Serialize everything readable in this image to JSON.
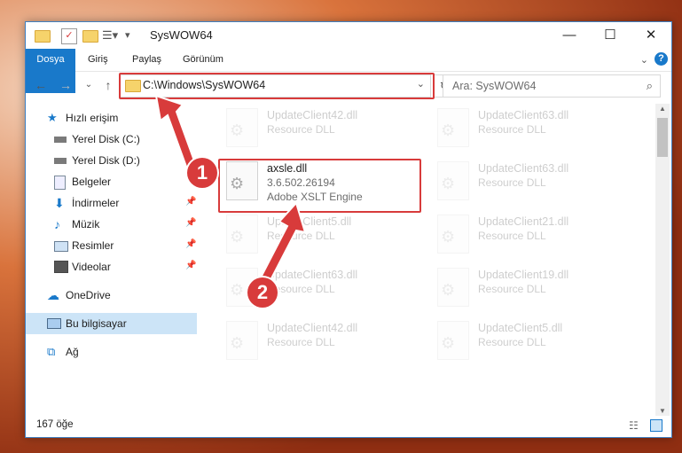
{
  "window": {
    "title": "SysWOW64"
  },
  "ribbon": {
    "tabs": [
      "Dosya",
      "Giriş",
      "Paylaş",
      "Görünüm"
    ],
    "help_icon": "?"
  },
  "nav": {
    "address": "C:\\Windows\\SysWOW64",
    "search_placeholder": "Ara: SysWOW64"
  },
  "sidebar": {
    "items": [
      {
        "label": "Hızlı erişim",
        "icon": "star-icon"
      },
      {
        "label": "Yerel Disk (C:)",
        "icon": "drive-icon"
      },
      {
        "label": "Yerel Disk (D:)",
        "icon": "drive-icon"
      },
      {
        "label": "Belgeler",
        "icon": "document-icon"
      },
      {
        "label": "İndirmeler",
        "icon": "download-icon"
      },
      {
        "label": "Müzik",
        "icon": "music-icon"
      },
      {
        "label": "Resimler",
        "icon": "picture-icon"
      },
      {
        "label": "Videolar",
        "icon": "video-icon"
      },
      {
        "label": "OneDrive",
        "icon": "cloud-icon"
      },
      {
        "label": "Bu bilgisayar",
        "icon": "computer-icon"
      },
      {
        "label": "Ağ",
        "icon": "network-icon"
      }
    ]
  },
  "files": [
    {
      "name": "UpdateClient42.dll",
      "type": "Resource DLL"
    },
    {
      "name": "UpdateClient63.dll",
      "type": "Resource DLL"
    },
    {
      "name": "axsle.dll",
      "version": "3.6.502.26194",
      "type": "Adobe XSLT Engine"
    },
    {
      "name": "UpdateClient63.dll",
      "type": "Resource DLL"
    },
    {
      "name": "UpdateClient5.dll",
      "type": "Resource DLL"
    },
    {
      "name": "UpdateClient21.dll",
      "type": "Resource DLL"
    },
    {
      "name": "UpdateClient63.dll",
      "type": "Resource DLL"
    },
    {
      "name": "UpdateClient19.dll",
      "type": "Resource DLL"
    },
    {
      "name": "UpdateClient42.dll",
      "type": "Resource DLL"
    },
    {
      "name": "UpdateClient5.dll",
      "type": "Resource DLL"
    }
  ],
  "status": {
    "count": "167 öğe"
  },
  "annotations": {
    "step1": "1",
    "step2": "2"
  },
  "colors": {
    "accent": "#1979ca",
    "highlight": "#d83b3b"
  }
}
